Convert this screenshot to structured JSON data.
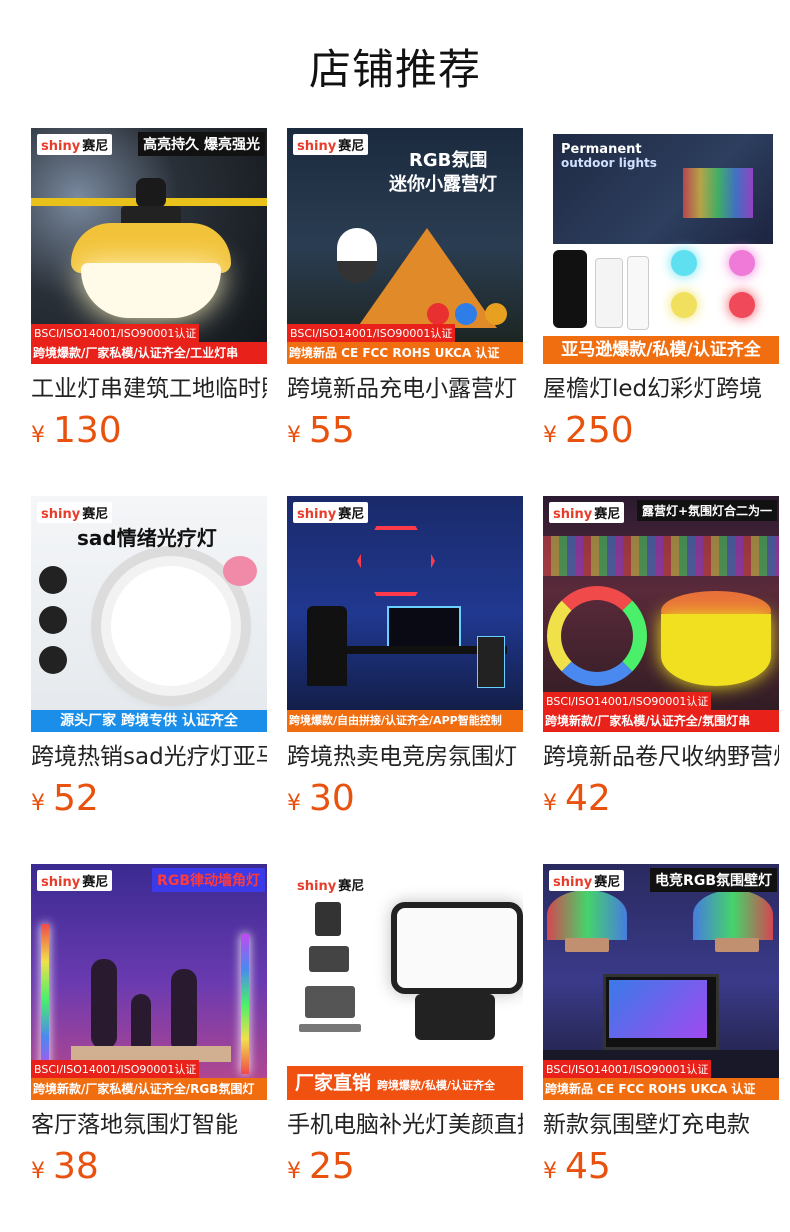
{
  "section_title": "店铺推荐",
  "products": [
    {
      "title": "工业灯串建筑工地临时照明",
      "price": "130",
      "brand": "shiny",
      "brand_cn": "赛尼",
      "banner": "高亮持久 爆亮强光",
      "certs": "BSCI/ISO14001/ISO90001认证",
      "bottom": "跨境爆款/厂家私模/认证齐全/工业灯串"
    },
    {
      "title": "跨境新品充电小露营灯",
      "price": "55",
      "brand": "shiny",
      "brand_cn": "赛尼",
      "headline1": "RGB氛围",
      "headline2": "迷你小露营灯",
      "certs": "BSCI/ISO14001/ISO90001认证",
      "bottom": "跨境新品 CE FCC ROHS UKCA 认证"
    },
    {
      "title": "屋檐灯led幻彩灯跨境",
      "price": "250",
      "box_text1": "Permanent",
      "box_text2": "outdoor lights",
      "bottom": "亚马逊爆款/私模/认证齐全"
    },
    {
      "title": "跨境热销sad光疗灯亚马逊",
      "price": "52",
      "brand": "shiny",
      "brand_cn": "赛尼",
      "headline1": "sad情绪光疗灯",
      "bottom": "源头厂家   跨境专供   认证齐全"
    },
    {
      "title": "跨境热卖电竞房氛围灯",
      "price": "30",
      "brand": "shiny",
      "brand_cn": "赛尼",
      "bottom": "跨境爆款/自由拼接/认证齐全/APP智能控制"
    },
    {
      "title": "跨境新品卷尺收纳野营灯",
      "price": "42",
      "brand": "shiny",
      "brand_cn": "赛尼",
      "banner": "露营灯+氛围灯合二为一",
      "certs": "BSCI/ISO14001/ISO90001认证",
      "bottom": "跨境新款/厂家私模/认证齐全/氛围灯串"
    },
    {
      "title": "客厅落地氛围灯智能",
      "price": "38",
      "brand": "shiny",
      "brand_cn": "赛尼",
      "banner": "RGB律动墙角灯",
      "certs": "BSCI/ISO14001/ISO90001认证",
      "bottom": "跨境新款/厂家私模/认证齐全/RGB氛围灯"
    },
    {
      "title": "手机电脑补光灯美颜直播",
      "price": "25",
      "brand": "shiny",
      "brand_cn": "赛尼",
      "bottom_big": "厂家直销",
      "bottom_small": "跨境爆款/私模/认证齐全"
    },
    {
      "title": "新款氛围壁灯充电款",
      "price": "45",
      "brand": "shiny",
      "brand_cn": "赛尼",
      "banner": "电竞RGB氛围壁灯",
      "certs": "BSCI/ISO14001/ISO90001认证",
      "bottom": "跨境新品 CE FCC ROHS UKCA 认证"
    }
  ],
  "currency": "¥",
  "colors": {
    "price": "#e8520e",
    "accent_orange": "#f06d10",
    "cert_red": "#e8221a"
  }
}
